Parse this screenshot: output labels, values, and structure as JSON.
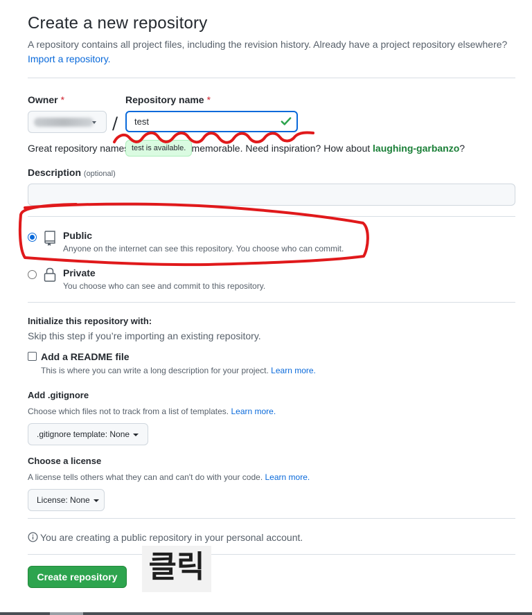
{
  "page": {
    "title": "Create a new repository",
    "subtitle": "A repository contains all project files, including the revision history. Already have a project repository elsewhere?",
    "import_link": "Import a repository."
  },
  "owner": {
    "label": "Owner",
    "required_mark": "*"
  },
  "repo_name": {
    "label": "Repository name",
    "required_mark": "*",
    "value": "test",
    "separator": "/",
    "availability_tooltip": "test is available."
  },
  "inspiration": {
    "text": "Great repository names are short and memorable. Need inspiration? How about ",
    "suggestion": "laughing-garbanzo",
    "end": "?"
  },
  "description": {
    "label": "Description",
    "optional": "(optional)",
    "value": ""
  },
  "visibility": {
    "public": {
      "title": "Public",
      "desc": "Anyone on the internet can see this repository. You choose who can commit.",
      "selected": true,
      "icon": "repo-icon"
    },
    "private": {
      "title": "Private",
      "desc": "You choose who can see and commit to this repository.",
      "selected": false,
      "icon": "lock-icon"
    }
  },
  "init": {
    "title": "Initialize this repository with:",
    "subtitle": "Skip this step if you’re importing an existing repository.",
    "readme": {
      "label": "Add a README file",
      "desc": "This is where you can write a long description for your project.",
      "learn_more": "Learn more.",
      "checked": false
    }
  },
  "gitignore": {
    "title": "Add .gitignore",
    "desc": "Choose which files not to track from a list of templates.",
    "learn_more": "Learn more.",
    "button": ".gitignore template: None"
  },
  "license": {
    "title": "Choose a license",
    "desc": "A license tells others what they can and can't do with your code.",
    "learn_more": "Learn more.",
    "button": "License: None"
  },
  "notice": {
    "text": "You are creating a public repository in your personal account.",
    "icon": "info-icon"
  },
  "submit": {
    "label": "Create repository"
  },
  "annotation": {
    "click_text": "클릭",
    "mark_color": "#e0191b"
  },
  "colors": {
    "accent": "#0969da",
    "success": "#2da44e",
    "danger": "#cf222e"
  }
}
